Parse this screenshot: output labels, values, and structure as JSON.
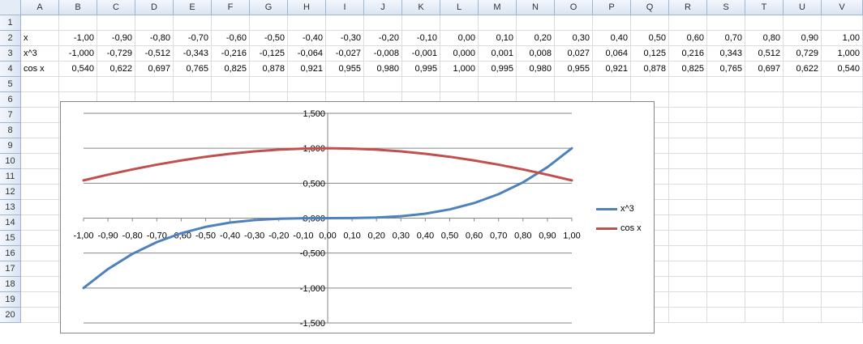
{
  "columns": [
    "A",
    "B",
    "C",
    "D",
    "E",
    "F",
    "G",
    "H",
    "I",
    "J",
    "K",
    "L",
    "M",
    "N",
    "O",
    "P",
    "Q",
    "R",
    "S",
    "T",
    "U",
    "V"
  ],
  "rows": [
    "1",
    "2",
    "3",
    "4",
    "5",
    "6",
    "7",
    "8",
    "9",
    "10",
    "11",
    "12",
    "13",
    "14",
    "15",
    "16",
    "17",
    "18",
    "19",
    "20"
  ],
  "table": {
    "x": {
      "label": "x",
      "values": [
        "-1,00",
        "-0,90",
        "-0,80",
        "-0,70",
        "-0,60",
        "-0,50",
        "-0,40",
        "-0,30",
        "-0,20",
        "-0,10",
        "0,00",
        "0,10",
        "0,20",
        "0,30",
        "0,40",
        "0,50",
        "0,60",
        "0,70",
        "0,80",
        "0,90",
        "1,00"
      ]
    },
    "x3": {
      "label": "x^3",
      "values": [
        "-1,000",
        "-0,729",
        "-0,512",
        "-0,343",
        "-0,216",
        "-0,125",
        "-0,064",
        "-0,027",
        "-0,008",
        "-0,001",
        "0,000",
        "0,001",
        "0,008",
        "0,027",
        "0,064",
        "0,125",
        "0,216",
        "0,343",
        "0,512",
        "0,729",
        "1,000"
      ]
    },
    "cosx": {
      "label": "cos x",
      "values": [
        "0,540",
        "0,622",
        "0,697",
        "0,765",
        "0,825",
        "0,878",
        "0,921",
        "0,955",
        "0,980",
        "0,995",
        "1,000",
        "0,995",
        "0,980",
        "0,955",
        "0,921",
        "0,878",
        "0,825",
        "0,765",
        "0,697",
        "0,622",
        "0,540"
      ]
    }
  },
  "chart_data": {
    "type": "line",
    "x": [
      -1.0,
      -0.9,
      -0.8,
      -0.7,
      -0.6,
      -0.5,
      -0.4,
      -0.3,
      -0.2,
      -0.1,
      0.0,
      0.1,
      0.2,
      0.3,
      0.4,
      0.5,
      0.6,
      0.7,
      0.8,
      0.9,
      1.0
    ],
    "x_tick_labels": [
      "-1,00",
      "-0,90",
      "-0,80",
      "-0,70",
      "-0,60",
      "-0,50",
      "-0,40",
      "-0,30",
      "-0,20",
      "-0,10",
      "0,00",
      "0,10",
      "0,20",
      "0,30",
      "0,40",
      "0,50",
      "0,60",
      "0,70",
      "0,80",
      "0,90",
      "1,00"
    ],
    "y_tick_labels": [
      "-1,500",
      "-1,000",
      "-0,500",
      "0,000",
      "0,500",
      "1,000",
      "1,500"
    ],
    "y_ticks": [
      -1.5,
      -1.0,
      -0.5,
      0.0,
      0.5,
      1.0,
      1.5
    ],
    "ylim": [
      -1.5,
      1.5
    ],
    "xlim": [
      -1.0,
      1.0
    ],
    "grid": true,
    "legend_position": "right",
    "series": [
      {
        "name": "x^3",
        "color": "#4f81bd",
        "values": [
          -1.0,
          -0.729,
          -0.512,
          -0.343,
          -0.216,
          -0.125,
          -0.064,
          -0.027,
          -0.008,
          -0.001,
          0.0,
          0.001,
          0.008,
          0.027,
          0.064,
          0.125,
          0.216,
          0.343,
          0.512,
          0.729,
          1.0
        ]
      },
      {
        "name": "cos x",
        "color": "#c0504d",
        "values": [
          0.54,
          0.622,
          0.697,
          0.765,
          0.825,
          0.878,
          0.921,
          0.955,
          0.98,
          0.995,
          1.0,
          0.995,
          0.98,
          0.955,
          0.921,
          0.878,
          0.825,
          0.765,
          0.697,
          0.622,
          0.54
        ]
      }
    ]
  },
  "colors": {
    "header_bg": "#dae5f3",
    "gridline": "#dadcdd",
    "series_x3": "#4f81bd",
    "series_cos": "#c0504d"
  }
}
